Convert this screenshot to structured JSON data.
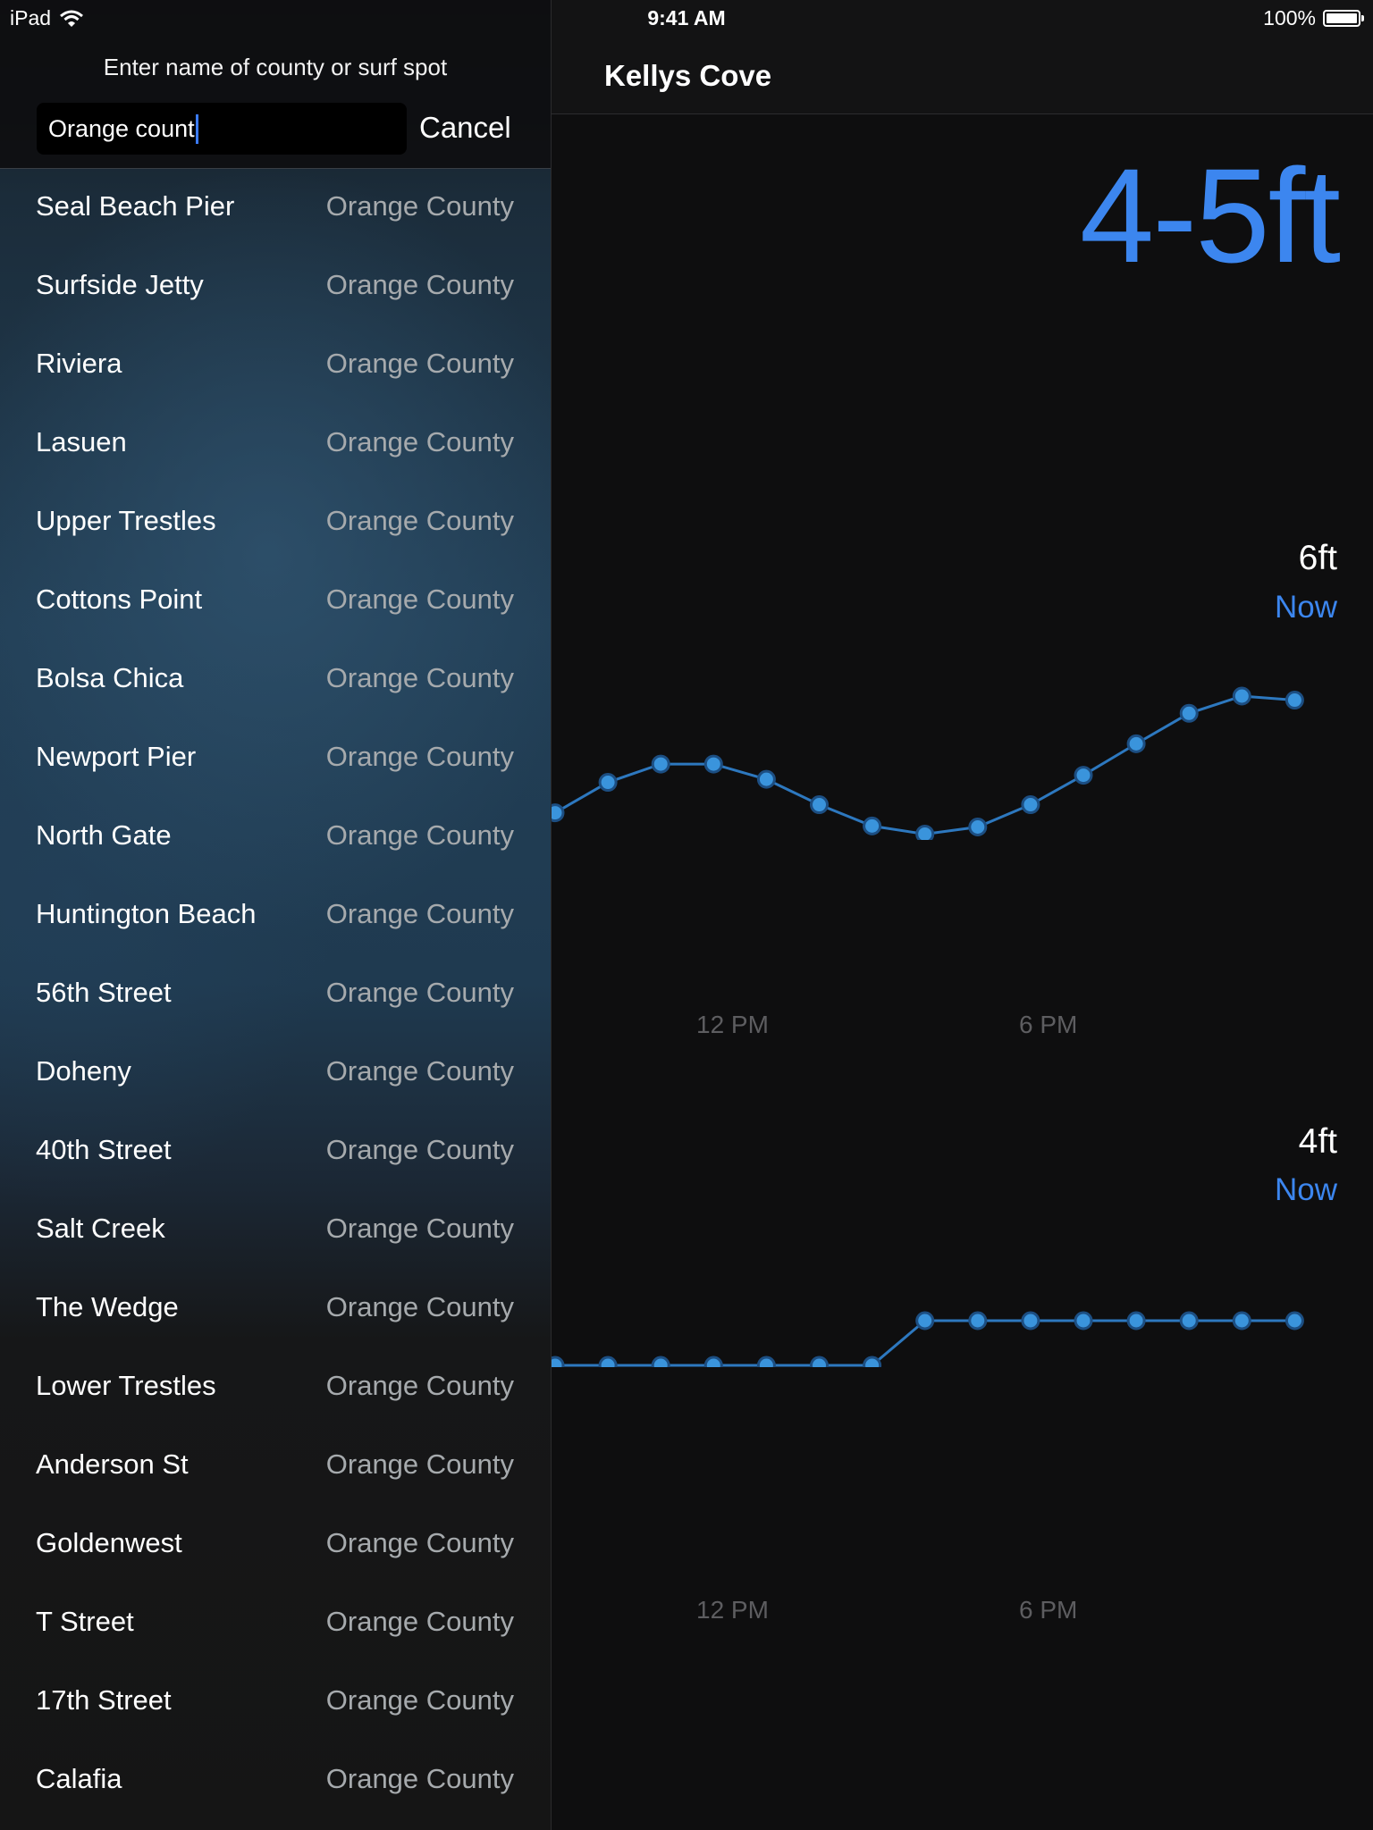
{
  "status_bar": {
    "device": "iPad",
    "time": "9:41 AM",
    "battery": "100%"
  },
  "search": {
    "prompt": "Enter name of county or surf spot",
    "value": "Orange count",
    "cancel_label": "Cancel"
  },
  "results": [
    {
      "spot": "Seal Beach Pier",
      "county": "Orange County"
    },
    {
      "spot": "Surfside Jetty",
      "county": "Orange County"
    },
    {
      "spot": "Riviera",
      "county": "Orange County"
    },
    {
      "spot": "Lasuen",
      "county": "Orange County"
    },
    {
      "spot": "Upper Trestles",
      "county": "Orange County"
    },
    {
      "spot": "Cottons Point",
      "county": "Orange County"
    },
    {
      "spot": "Bolsa Chica",
      "county": "Orange County"
    },
    {
      "spot": "Newport Pier",
      "county": "Orange County"
    },
    {
      "spot": "North Gate",
      "county": "Orange County"
    },
    {
      "spot": "Huntington Beach",
      "county": "Orange County"
    },
    {
      "spot": "56th Street",
      "county": "Orange County"
    },
    {
      "spot": "Doheny",
      "county": "Orange County"
    },
    {
      "spot": "40th Street",
      "county": "Orange County"
    },
    {
      "spot": "Salt Creek",
      "county": "Orange County"
    },
    {
      "spot": "The Wedge",
      "county": "Orange County"
    },
    {
      "spot": "Lower Trestles",
      "county": "Orange County"
    },
    {
      "spot": "Anderson St",
      "county": "Orange County"
    },
    {
      "spot": "Goldenwest",
      "county": "Orange County"
    },
    {
      "spot": "T Street",
      "county": "Orange County"
    },
    {
      "spot": "17th Street",
      "county": "Orange County"
    },
    {
      "spot": "Calafia",
      "county": "Orange County"
    }
  ],
  "forecast": {
    "spot_name": "Kellys Cove",
    "surf_height": "4-5ft",
    "charts": [
      {
        "value_label": "6ft",
        "now_label": "Now",
        "x_labels": [
          "12 PM",
          "6 PM"
        ],
        "values": [
          4.95,
          5.25,
          5.43,
          5.43,
          5.28,
          5.03,
          4.82,
          4.74,
          4.81,
          5.03,
          5.32,
          5.63,
          5.93,
          6.1,
          6.06
        ]
      },
      {
        "value_label": "4ft",
        "now_label": "Now",
        "x_labels": [
          "12 PM",
          "6 PM"
        ],
        "values": [
          3,
          3,
          3,
          3,
          3,
          3,
          3,
          4,
          4,
          4,
          4,
          4,
          4,
          4,
          4
        ]
      }
    ],
    "accent_color": "#3c86ef",
    "point_color": "#3a94dc"
  }
}
